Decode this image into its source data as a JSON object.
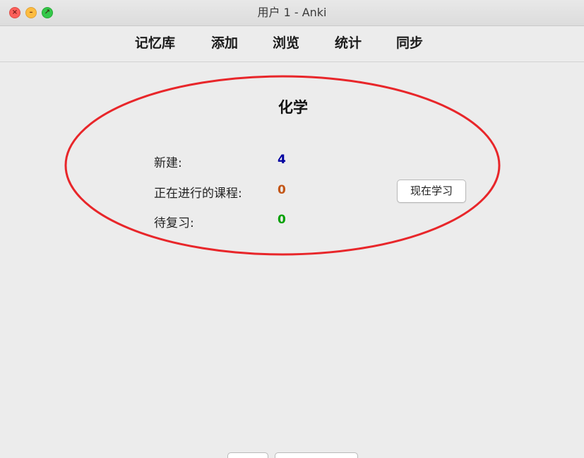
{
  "window": {
    "title": "用户 1 - Anki"
  },
  "menu": {
    "decks": "记忆库",
    "add": "添加",
    "browse": "浏览",
    "stats": "统计",
    "sync": "同步"
  },
  "deck": {
    "name": "化学",
    "new_label": "新建:",
    "new_count": "4",
    "learning_label": "正在进行的课程:",
    "learning_count": "0",
    "review_label": "待复习:",
    "review_count": "0",
    "study_button": "现在学习"
  },
  "colors": {
    "new": "#0000a0",
    "learning": "#c35617",
    "review": "#00a000",
    "annotation_ellipse": "#e8262a"
  },
  "icons": {
    "close": "close-icon",
    "minimize": "minimize-icon",
    "maximize": "fullscreen-icon"
  }
}
